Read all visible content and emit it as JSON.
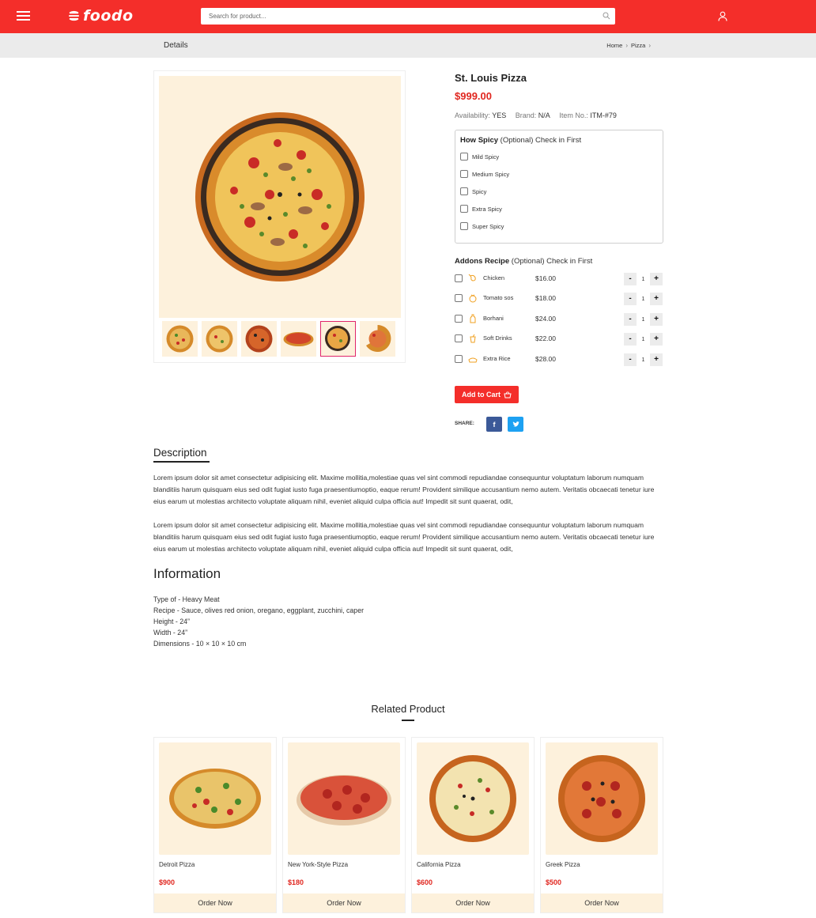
{
  "brand": {
    "name": "foodo",
    "accent": "#f42e2a"
  },
  "search": {
    "placeholder": "Search for product..."
  },
  "header": {
    "menu_icon": "hamburger-icon",
    "user_icon": "user-icon",
    "search_icon": "search-icon"
  },
  "breadcrumb": {
    "title": "Details",
    "items": [
      "Home",
      "Pizza"
    ]
  },
  "product": {
    "name": "St. Louis Pizza",
    "price": "$999.00",
    "availability_label": "Availability:",
    "availability_value": "YES",
    "brand_label": "Brand:",
    "brand_value": "N/A",
    "item_label": "Item No.:",
    "item_value": "ITM-#79",
    "active_thumb_index": 4
  },
  "spicy": {
    "title_bold": "How Spicy",
    "title_rest": " (Optional) Check in First",
    "options": [
      "Mild Spicy",
      "Medium Spicy",
      "Spicy",
      "Extra Spicy",
      "Super Spicy"
    ]
  },
  "addons": {
    "title_bold": "Addons Recipe",
    "title_rest": " (Optional) Check in First",
    "items": [
      {
        "name": "Chicken",
        "price": "$16.00",
        "qty": "1",
        "icon": "chicken-icon"
      },
      {
        "name": "Tomato sos",
        "price": "$18.00",
        "qty": "1",
        "icon": "tomato-icon"
      },
      {
        "name": "Borhani",
        "price": "$24.00",
        "qty": "1",
        "icon": "drink-bottle-icon"
      },
      {
        "name": "Soft Drinks",
        "price": "$22.00",
        "qty": "1",
        "icon": "soft-drink-icon"
      },
      {
        "name": "Extra Rice",
        "price": "$28.00",
        "qty": "1",
        "icon": "rice-icon"
      }
    ],
    "minus": "-",
    "plus": "+"
  },
  "cart": {
    "label": "Add to Cart",
    "icon": "basket-icon"
  },
  "share": {
    "label": "SHARE:",
    "facebook": "f",
    "twitter_icon": "twitter-icon"
  },
  "description": {
    "heading": "Description",
    "paragraphs": [
      "Lorem ipsum dolor sit amet consectetur adipisicing elit. Maxime mollitia,molestiae quas vel sint commodi repudiandae consequuntur voluptatum laborum numquam blanditiis harum quisquam eius sed odit fugiat iusto fuga praesentiumoptio, eaque rerum! Provident similique accusantium nemo autem. Veritatis obcaecati tenetur iure eius earum ut molestias architecto voluptate aliquam nihil, eveniet aliquid culpa officia aut! Impedit sit sunt quaerat, odit,",
      "Lorem ipsum dolor sit amet consectetur adipisicing elit. Maxime mollitia,molestiae quas vel sint commodi repudiandae consequuntur voluptatum laborum numquam blanditiis harum quisquam eius sed odit fugiat iusto fuga praesentiumoptio, eaque rerum! Provident similique accusantium nemo autem. Veritatis obcaecati tenetur iure eius earum ut molestias architecto voluptate aliquam nihil, eveniet aliquid culpa officia aut! Impedit sit sunt quaerat, odit,"
    ]
  },
  "information": {
    "heading": "Information",
    "lines": [
      "Type of - Heavy Meat",
      "Recipe - Sauce, olives red onion, oregano, eggplant, zucchini, caper",
      "Height - 24”",
      "Width - 24”",
      "Dimensions - 10 × 10 × 10 cm"
    ]
  },
  "related": {
    "heading": "Related Product",
    "order_label": "Order Now",
    "products": [
      {
        "name": "Detroit Pizza",
        "price": "$900"
      },
      {
        "name": "New York-Style Pizza",
        "price": "$180"
      },
      {
        "name": "California Pizza",
        "price": "$600"
      },
      {
        "name": "Greek Pizza",
        "price": "$500"
      }
    ]
  }
}
